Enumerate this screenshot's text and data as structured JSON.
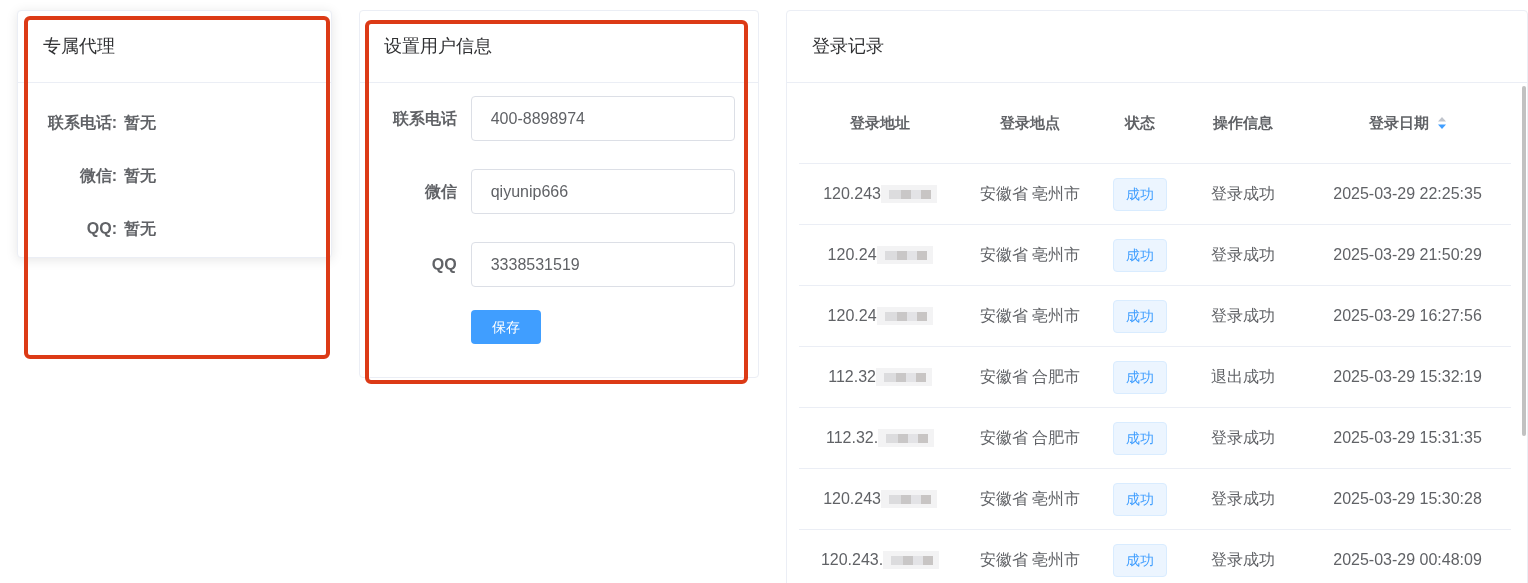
{
  "agent_card": {
    "title": "专属代理",
    "fields": [
      {
        "label": "联系电话:",
        "value": "暂无"
      },
      {
        "label": "微信:",
        "value": "暂无"
      },
      {
        "label": "QQ:",
        "value": "暂无"
      }
    ]
  },
  "user_info_card": {
    "title": "设置用户信息",
    "fields": [
      {
        "label": "联系电话",
        "value": "400-8898974"
      },
      {
        "label": "微信",
        "value": "qiyunip666"
      },
      {
        "label": "QQ",
        "value": "3338531519"
      }
    ],
    "save_button": "保存"
  },
  "login_records": {
    "title": "登录记录",
    "columns": [
      {
        "label": "登录地址",
        "sorted_descending": false
      },
      {
        "label": "登录地点",
        "sorted_descending": false
      },
      {
        "label": "状态",
        "sorted_descending": false
      },
      {
        "label": "操作信息",
        "sorted_descending": false
      },
      {
        "label": "登录日期",
        "sorted_descending": true
      }
    ],
    "rows": [
      {
        "address": "120.243",
        "place": "安徽省 亳州市",
        "status": "成功",
        "info": "登录成功",
        "date": "2025-03-29 22:25:35"
      },
      {
        "address": "120.24",
        "place": "安徽省 亳州市",
        "status": "成功",
        "info": "登录成功",
        "date": "2025-03-29 21:50:29"
      },
      {
        "address": "120.24",
        "place": "安徽省 亳州市",
        "status": "成功",
        "info": "登录成功",
        "date": "2025-03-29 16:27:56"
      },
      {
        "address": "112.32",
        "place": "安徽省 合肥市",
        "status": "成功",
        "info": "退出成功",
        "date": "2025-03-29 15:32:19"
      },
      {
        "address": "112.32.",
        "place": "安徽省 合肥市",
        "status": "成功",
        "info": "登录成功",
        "date": "2025-03-29 15:31:35"
      },
      {
        "address": "120.243",
        "place": "安徽省 亳州市",
        "status": "成功",
        "info": "登录成功",
        "date": "2025-03-29 15:30:28"
      },
      {
        "address": "120.243.",
        "place": "安徽省 亳州市",
        "status": "成功",
        "info": "登录成功",
        "date": "2025-03-29 00:48:09"
      }
    ]
  }
}
